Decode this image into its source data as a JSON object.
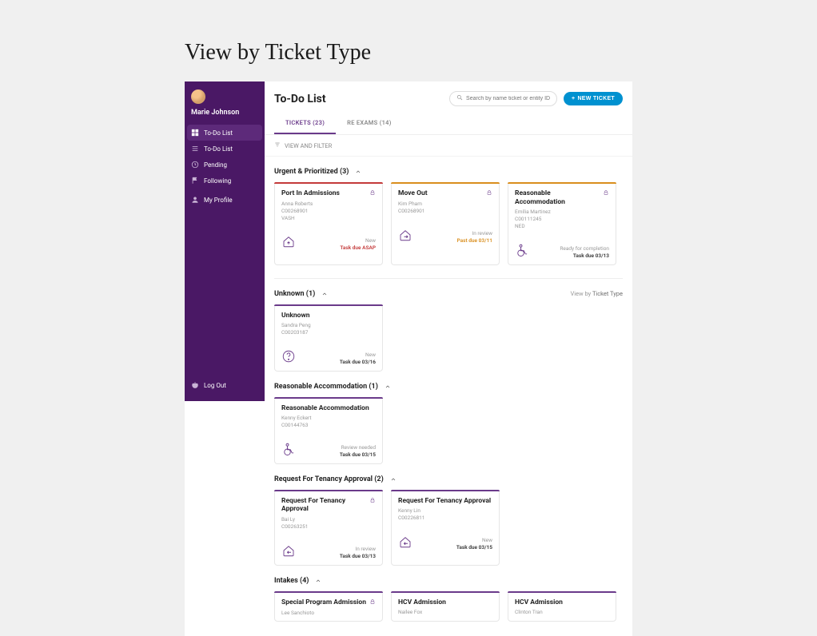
{
  "page_heading": "View by Ticket Type",
  "user": {
    "name": "Marie Johnson"
  },
  "nav": {
    "items": [
      {
        "label": "To-Do List",
        "icon": "grid",
        "active": true
      },
      {
        "label": "To-Do List",
        "icon": "list",
        "active": false
      },
      {
        "label": "Pending",
        "icon": "clock",
        "active": false
      },
      {
        "label": "Following",
        "icon": "flag",
        "active": false
      }
    ],
    "profile_label": "My Profile",
    "logout_label": "Log Out"
  },
  "header": {
    "title": "To-Do List",
    "search_placeholder": "Search by name ticket or entity ID",
    "new_ticket_label": "NEW TICKET"
  },
  "tabs": [
    {
      "label": "TICKETS (23)",
      "active": true
    },
    {
      "label": "RE EXAMS (14)",
      "active": false
    }
  ],
  "filter_label": "VIEW AND FILTER",
  "view_by_prefix": "View by",
  "view_by_value": "Ticket Type",
  "sections": [
    {
      "title": "Urgent & Prioritized (3)",
      "show_view_by": false,
      "cards": [
        {
          "title": "Port In Admissions",
          "lock": true,
          "topbar": "red",
          "person": "Anna Roberts",
          "id": "C00268901",
          "extra": "VASH",
          "icon": "house-up",
          "status": "New",
          "due": "Task due ASAP",
          "due_class": "red"
        },
        {
          "title": "Move Out",
          "lock": true,
          "topbar": "orange",
          "person": "Kim Pham",
          "id": "C00268901",
          "extra": "",
          "icon": "house-out",
          "status": "In review",
          "due": "Past due 03/11",
          "due_class": "orange"
        },
        {
          "title": "Reasonable Accommodation",
          "lock": true,
          "topbar": "orange",
          "person": "Emilia Martinez",
          "id": "C00111245",
          "extra": "NED",
          "icon": "wheelchair",
          "status": "Ready for completion",
          "due": "Task due 03/13",
          "due_class": ""
        }
      ]
    },
    {
      "title": "Unknown (1)",
      "show_view_by": true,
      "cards": [
        {
          "title": "Unknown",
          "lock": false,
          "topbar": "purple",
          "person": "Sandra Peng",
          "id": "C00203187",
          "extra": "",
          "icon": "question",
          "status": "New",
          "due": "Task due 03/16",
          "due_class": ""
        }
      ]
    },
    {
      "title": "Reasonable Accommodation (1)",
      "show_view_by": false,
      "cards": [
        {
          "title": "Reasonable Accommodation",
          "lock": false,
          "topbar": "purple",
          "person": "Kenny Eckert",
          "id": "C00144763",
          "extra": "",
          "icon": "wheelchair",
          "status": "Review needed",
          "due": "Task due 03/15",
          "due_class": ""
        }
      ]
    },
    {
      "title": "Request For Tenancy Approval (2)",
      "show_view_by": false,
      "cards": [
        {
          "title": "Request For Tenancy Approval",
          "lock": true,
          "topbar": "purple",
          "person": "Bai Ly",
          "id": "C00263251",
          "extra": "",
          "icon": "house-in",
          "status": "In review",
          "due": "Task due 03/13",
          "due_class": ""
        },
        {
          "title": "Request For Tenancy Approval",
          "lock": false,
          "topbar": "purple",
          "person": "Kenny Lin",
          "id": "C00226811",
          "extra": "",
          "icon": "house-in",
          "status": "New",
          "due": "Task due 03/15",
          "due_class": ""
        }
      ]
    },
    {
      "title": "Intakes (4)",
      "show_view_by": false,
      "cards": [
        {
          "title": "Special Program Admission",
          "lock": true,
          "topbar": "purple",
          "person": "Lee Sanchioto",
          "id": "",
          "extra": "",
          "icon": "",
          "status": "",
          "due": "",
          "due_class": ""
        },
        {
          "title": "HCV Admission",
          "lock": false,
          "topbar": "purple",
          "person": "Nailee Fox",
          "id": "",
          "extra": "",
          "icon": "",
          "status": "",
          "due": "",
          "due_class": ""
        },
        {
          "title": "HCV Admission",
          "lock": false,
          "topbar": "purple",
          "person": "Clinton Tran",
          "id": "",
          "extra": "",
          "icon": "",
          "status": "",
          "due": "",
          "due_class": ""
        }
      ]
    }
  ]
}
